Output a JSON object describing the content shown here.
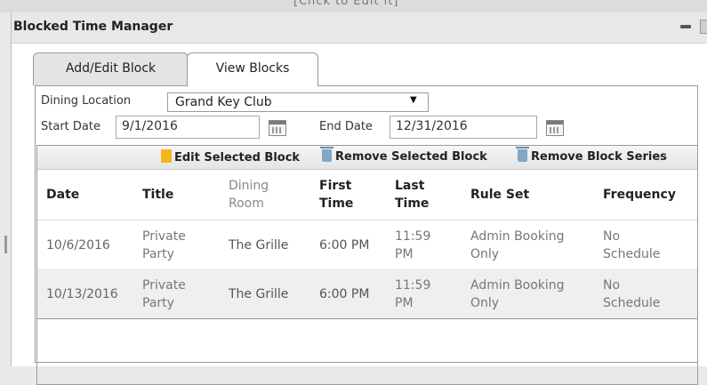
{
  "background_hint": "[Click to Edit it]",
  "window": {
    "title": "Blocked Time Manager"
  },
  "tabs": [
    {
      "label": "Add/Edit Block"
    },
    {
      "label": "View Blocks"
    }
  ],
  "filters": {
    "dining_location_label": "Dining Location",
    "dining_location_value": "Grand Key Club",
    "start_date_label": "Start Date",
    "start_date_value": "9/1/2016",
    "end_date_label": "End Date",
    "end_date_value": "12/31/2016"
  },
  "toolbar": {
    "edit_label": "Edit Selected Block",
    "remove_label": "Remove Selected Block",
    "remove_series_label": "Remove Block Series"
  },
  "table": {
    "columns": [
      [
        "Date"
      ],
      [
        "Title"
      ],
      [
        "Dining",
        "Room"
      ],
      [
        "First",
        "Time"
      ],
      [
        "Last",
        "Time"
      ],
      [
        "Rule Set"
      ],
      [
        "Frequency"
      ]
    ],
    "rows": [
      {
        "date": "10/6/2016",
        "title": [
          "Private",
          "Party"
        ],
        "room": "The Grille",
        "first": "6:00 PM",
        "last": [
          "11:59",
          "PM"
        ],
        "ruleset": [
          "Admin Booking",
          "Only"
        ],
        "frequency": [
          "No",
          "Schedule"
        ]
      },
      {
        "date": "10/13/2016",
        "title": [
          "Private",
          "Party"
        ],
        "room": "The Grille",
        "first": "6:00 PM",
        "last": [
          "11:59",
          "PM"
        ],
        "ruleset": [
          "Admin Booking",
          "Only"
        ],
        "frequency": [
          "No",
          "Schedule"
        ]
      }
    ]
  }
}
